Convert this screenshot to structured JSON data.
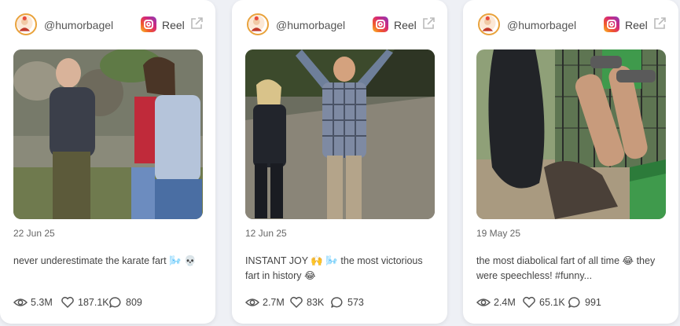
{
  "cards": [
    {
      "handle": "@humorbagel",
      "platform_label": "Reel",
      "date": "22 Jun 25",
      "caption": "never underestimate the karate fart 🌬️ 💀",
      "views": "5.3M",
      "likes": "187.1K",
      "comments": "809"
    },
    {
      "handle": "@humorbagel",
      "platform_label": "Reel",
      "date": "12 Jun 25",
      "caption": "INSTANT JOY 🙌 🌬️ the most victorious fart in history 😂",
      "views": "2.7M",
      "likes": "83K",
      "comments": "573"
    },
    {
      "handle": "@humorbagel",
      "platform_label": "Reel",
      "date": "19 May 25",
      "caption": "the most diabolical fart of all time 😂 they were speechless! #funny...",
      "views": "2.4M",
      "likes": "65.1K",
      "comments": "991"
    }
  ],
  "icons": {
    "platform": "instagram-icon",
    "open": "external-link-icon",
    "views": "eye-icon",
    "likes": "heart-icon",
    "comments": "comment-icon"
  },
  "colors": {
    "background": "#eef0f5",
    "card": "#ffffff",
    "avatar_ring": "#e9a23b"
  }
}
